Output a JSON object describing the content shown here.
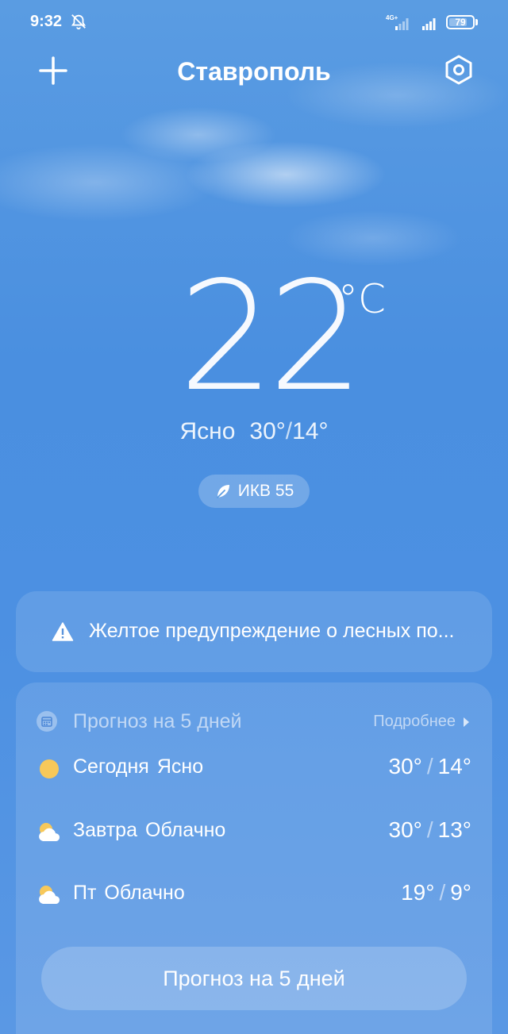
{
  "status_bar": {
    "time": "9:32",
    "network": "4G+",
    "battery": "79"
  },
  "header": {
    "city": "Ставрополь"
  },
  "current": {
    "temperature": "22",
    "unit": "°C",
    "condition": "Ясно",
    "high": "30°",
    "low": "14°",
    "high_low_separator": "/",
    "aqi_label": "ИКВ 55"
  },
  "warning": {
    "text": "Желтое предупреждение о лесных по..."
  },
  "forecast": {
    "title": "Прогноз на 5 дней",
    "more_label": "Подробнее",
    "days": [
      {
        "day": "Сегодня",
        "condition": "Ясно",
        "high": "30°",
        "low": "14°",
        "icon": "sun-icon"
      },
      {
        "day": "Завтра",
        "condition": "Облачно",
        "high": "30°",
        "low": "13°",
        "icon": "partly-cloudy-icon"
      },
      {
        "day": "Пт",
        "condition": "Облачно",
        "high": "19°",
        "low": "9°",
        "icon": "partly-cloudy-icon"
      }
    ],
    "separator": "/",
    "button_label": "Прогноз на 5 дней"
  },
  "colors": {
    "background": "#4a8fe0",
    "sun": "#f7c85a"
  }
}
